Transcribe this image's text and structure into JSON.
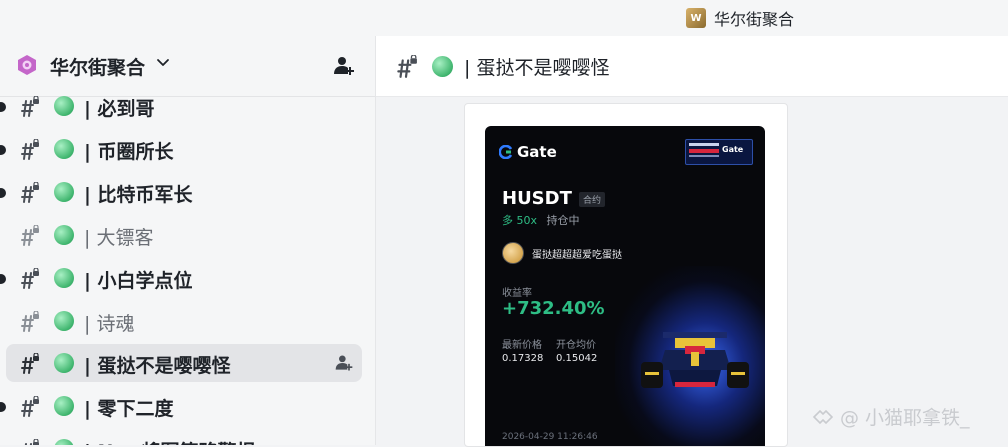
{
  "top_bar": {
    "server_tag": "华尔街聚合"
  },
  "guild": {
    "name": "华尔街聚合"
  },
  "channels": [
    {
      "name": "| 必到哥",
      "bold": true,
      "unread": true
    },
    {
      "name": "| 币圈所长",
      "bold": true,
      "unread": true
    },
    {
      "name": "| 比特币军长",
      "bold": true,
      "unread": true
    },
    {
      "name": "| 大镖客",
      "bold": false,
      "unread": false
    },
    {
      "name": "| 小白学点位",
      "bold": true,
      "unread": true
    },
    {
      "name": "| 诗魂",
      "bold": false,
      "unread": false
    },
    {
      "name": "| 蛋挞不是嘤嘤怪",
      "bold": true,
      "unread": false,
      "active": true
    },
    {
      "name": "| 零下二度",
      "bold": true,
      "unread": true
    },
    {
      "name": "| Nn‑ 将军策略警报",
      "bold": true,
      "unread": true
    }
  ],
  "main_header": {
    "title": "| 蛋挞不是嘤嘤怪"
  },
  "poster": {
    "brand": "Gate",
    "sponsor_label": "Gate",
    "pair": "HUSDT",
    "contract_badge": "合约",
    "side": "多 50x",
    "position_state": "持仓中",
    "user_name": "蛋挞超超超爱吃蛋挞",
    "roi_label": "收益率",
    "roi_value": "+732.40%",
    "last_price_label": "最新价格",
    "last_price_value": "0.17328",
    "entry_price_label": "开仓均价",
    "entry_price_value": "0.15042",
    "timestamp": "2026-04-29 11:26:46"
  },
  "watermark": "@ 小猫耶拿铁_",
  "colors": {
    "accent_green": "#2ebd85",
    "channel_dot": "#3fb56e",
    "poster_bg": "#07080c"
  }
}
